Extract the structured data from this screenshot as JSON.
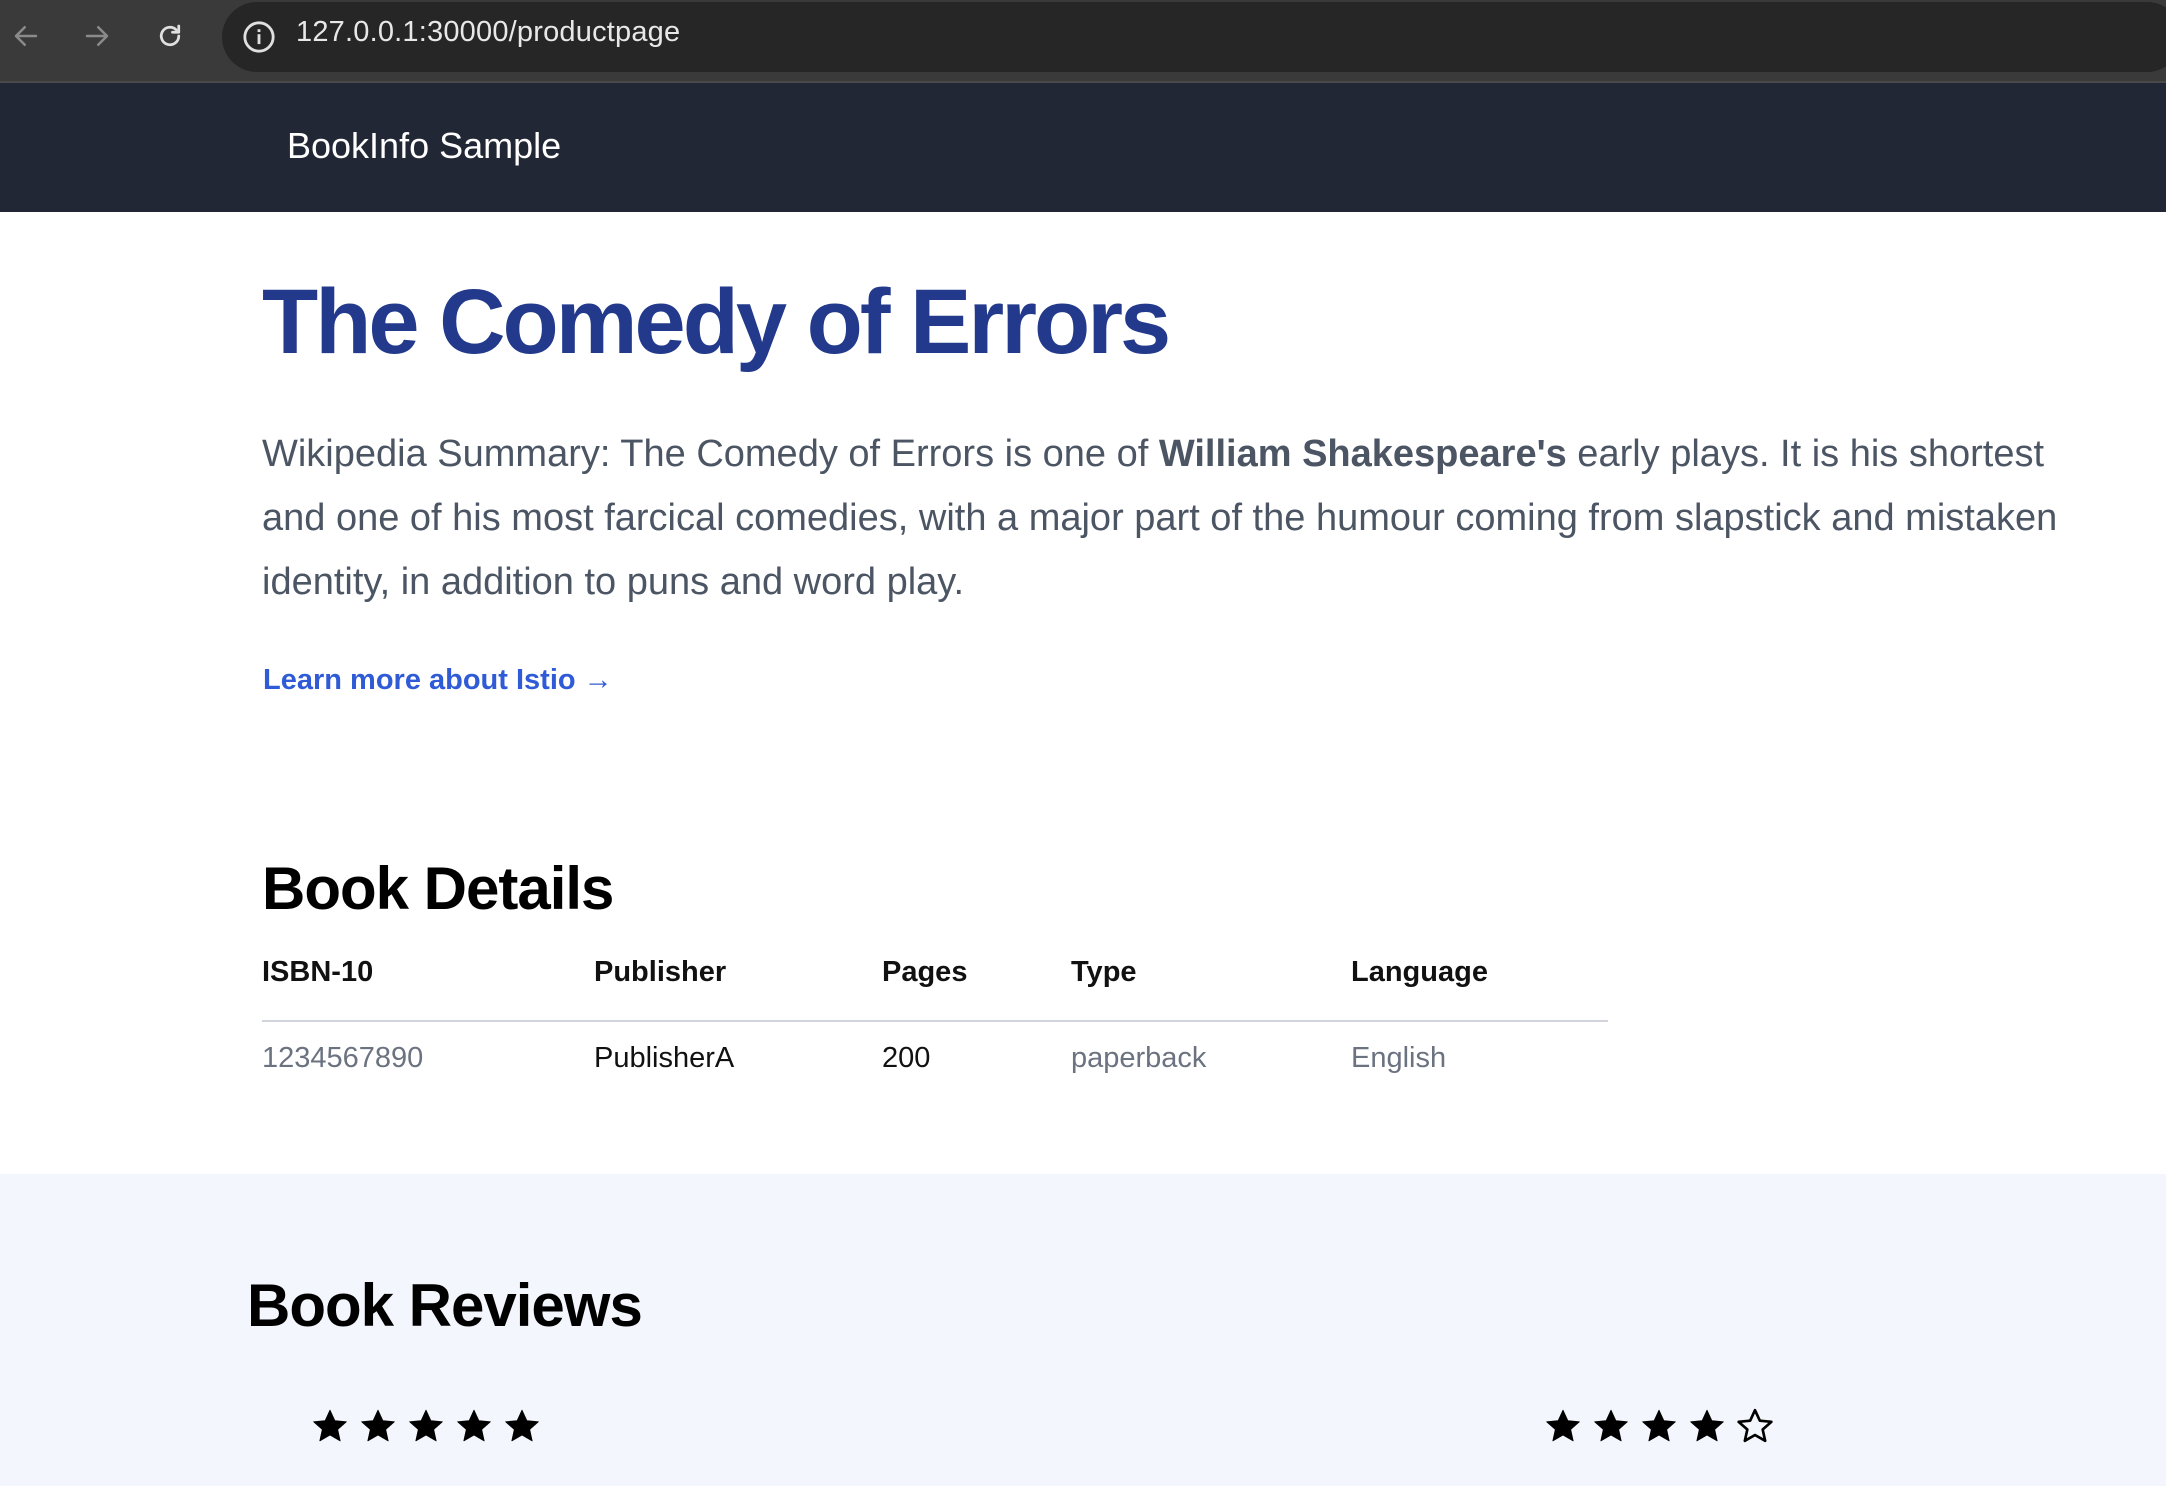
{
  "browser": {
    "url": "127.0.0.1:30000/productpage"
  },
  "navbar": {
    "brand": "BookInfo Sample"
  },
  "product": {
    "title": "The Comedy of Errors",
    "summary_prefix": "Wikipedia Summary: The Comedy of Errors is one of ",
    "summary_bold": "William Shakespeare's",
    "summary_suffix": " early plays. It is his shortest and one of his most farcical comedies, with a major part of the humour coming from slapstick and mistaken identity, in addition to puns and word play.",
    "learn_more": "Learn more about Istio →"
  },
  "details": {
    "heading": "Book Details",
    "columns": [
      "ISBN-10",
      "Publisher",
      "Pages",
      "Type",
      "Language"
    ],
    "row": [
      "1234567890",
      "PublisherA",
      "200",
      "paperback",
      "English"
    ]
  },
  "reviews": {
    "heading": "Book Reviews",
    "ratings": [
      5,
      4
    ],
    "max_rating": 5
  },
  "colors": {
    "title": "#233a8c",
    "link": "#2f5bd6",
    "navbar_bg": "#222735",
    "reviews_bg": "#f3f6fd"
  }
}
